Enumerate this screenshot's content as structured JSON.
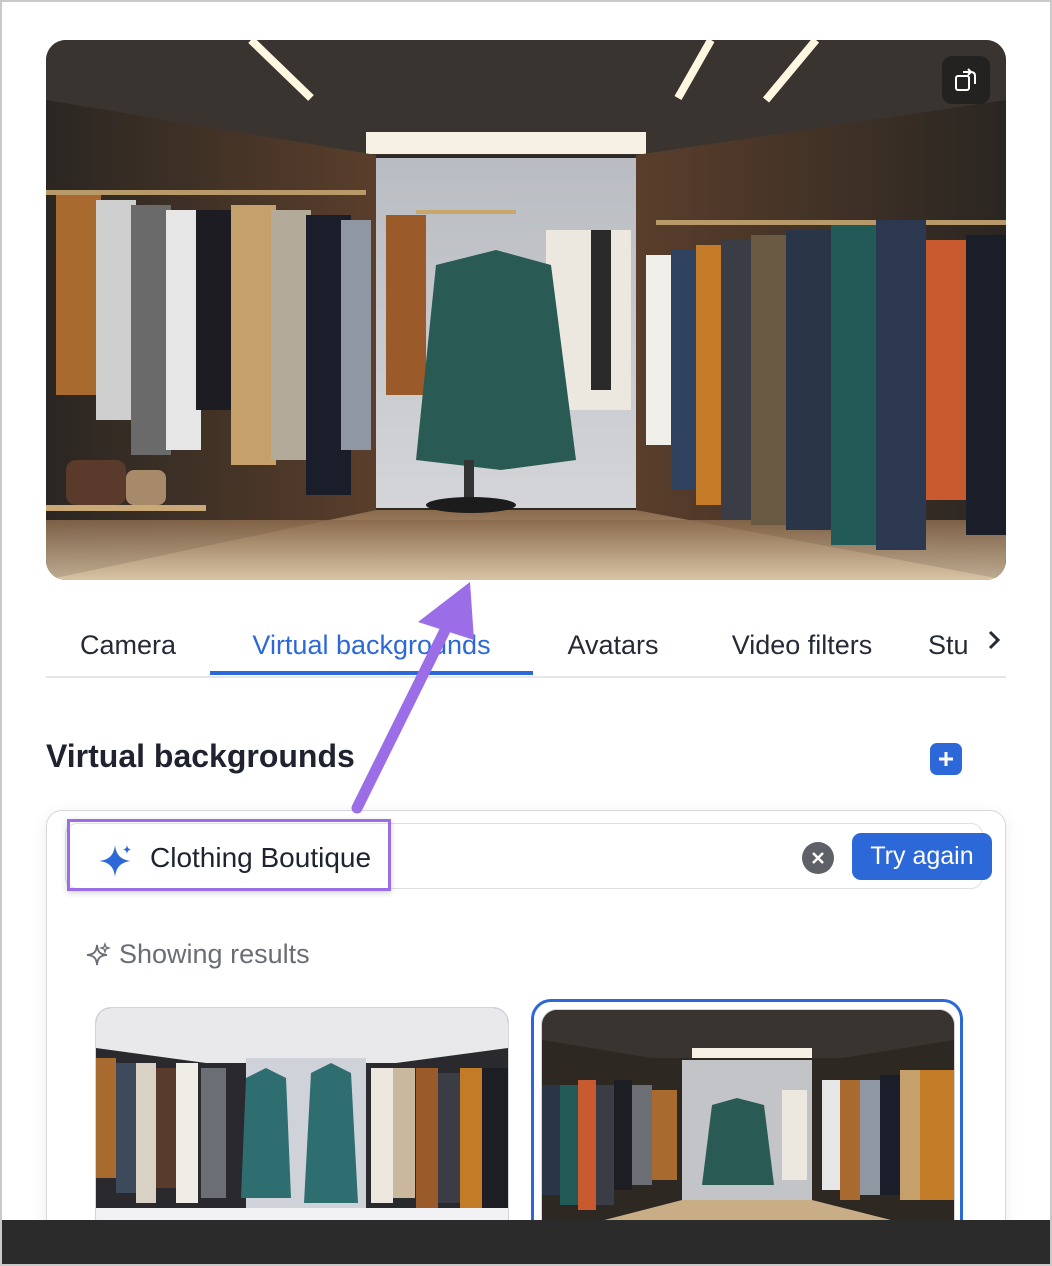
{
  "tabs": [
    {
      "label": "Camera",
      "active": false
    },
    {
      "label": "Virtual backgrounds",
      "active": true
    },
    {
      "label": "Avatars",
      "active": false
    },
    {
      "label": "Video filters",
      "active": false
    },
    {
      "label": "Stu",
      "active": false
    }
  ],
  "tabs_overflow_icon": "chevron-right-icon",
  "section": {
    "title": "Virtual backgrounds",
    "add_icon": "plus-icon"
  },
  "prompt": {
    "value": "Clothing Boutique",
    "icon": "sparkle-icon",
    "clear_icon": "close-circle-icon",
    "try_again_label": "Try again"
  },
  "results": {
    "label": "Showing results",
    "icon": "sparkle-outline-icon",
    "thumbnails": [
      {
        "name": "boutique-result-1",
        "selected": false
      },
      {
        "name": "boutique-result-2",
        "selected": true
      }
    ]
  },
  "preview": {
    "rotate_icon": "rotate-icon"
  },
  "colors": {
    "accent": "#2d68d8",
    "annotation": "#9b6ee8",
    "text": "#1f2330",
    "muted": "#6a6d75"
  }
}
